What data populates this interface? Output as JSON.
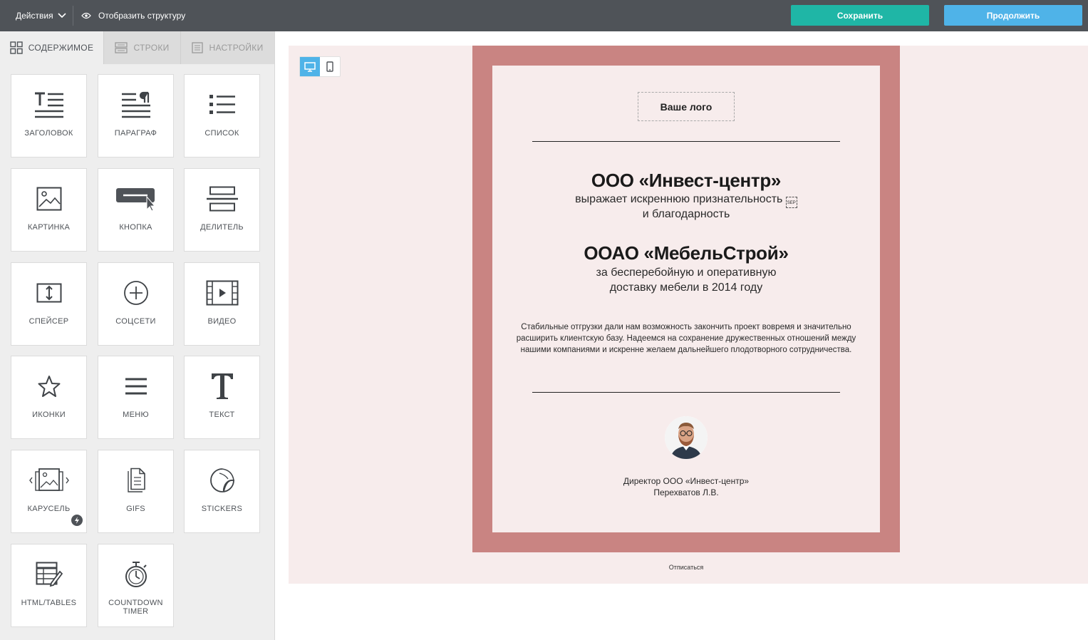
{
  "topbar": {
    "actions_label": "Действия",
    "structure_label": "Отобразить структуру",
    "save_label": "Сохранить",
    "continue_label": "Продолжить"
  },
  "sidebar": {
    "tabs": [
      {
        "label": "СОДЕРЖИМОЕ",
        "icon": "grid-icon",
        "active": true
      },
      {
        "label": "СТРОКИ",
        "icon": "rows-icon",
        "active": false
      },
      {
        "label": "НАСТРОЙКИ",
        "icon": "settings-doc-icon",
        "active": false
      }
    ],
    "blocks": [
      {
        "label": "ЗАГОЛОВОК",
        "icon": "heading-icon"
      },
      {
        "label": "ПАРАГРАФ",
        "icon": "paragraph-icon"
      },
      {
        "label": "СПИСОК",
        "icon": "list-icon"
      },
      {
        "label": "КАРТИНКА",
        "icon": "image-icon"
      },
      {
        "label": "КНОПКА",
        "icon": "button-icon"
      },
      {
        "label": "ДЕЛИТЕЛЬ",
        "icon": "divider-icon"
      },
      {
        "label": "СПЕЙСЕР",
        "icon": "spacer-icon"
      },
      {
        "label": "СОЦСЕТИ",
        "icon": "social-icon"
      },
      {
        "label": "ВИДЕО",
        "icon": "video-icon"
      },
      {
        "label": "ИКОНКИ",
        "icon": "star-icon"
      },
      {
        "label": "МЕНЮ",
        "icon": "menu-icon"
      },
      {
        "label": "ТЕКСТ",
        "icon": "text-icon"
      },
      {
        "label": "КАРУСЕЛЬ",
        "icon": "carousel-icon"
      },
      {
        "label": "GIFS",
        "icon": "gifs-icon"
      },
      {
        "label": "STICKERS",
        "icon": "sticker-icon"
      },
      {
        "label": "HTML/TABLES",
        "icon": "html-tables-icon"
      },
      {
        "label": "COUNTDOWN TIMER",
        "icon": "timer-icon"
      }
    ]
  },
  "email": {
    "logo_placeholder": "Ваше лого",
    "company_from": "ООО «Инвест-центр»",
    "gratitude_line1": "выражает искреннюю признательность ",
    "gratitude_line2": "и благодарность",
    "company_to": "ООАО «МебельСтрой»",
    "reason_line1": "за бесперебойную и оперативную",
    "reason_line2": "доставку мебели в 2014 году",
    "body_text": "Стабильные отгрузки дали нам возможность закончить проект вовремя и значительно расширить клиентскую базу. Надеемся на сохранение дружественных отношений между нашими компаниями и искренне желаем дальнейшего плодотворного сотрудничества.",
    "signer_title": "Директор ООО «Инвест-центр»",
    "signer_name": "Перехватов Л.В.",
    "unsubscribe": "Отписаться"
  },
  "colors": {
    "topbar": "#4f5358",
    "save": "#1fb6a6",
    "continue": "#4fb3e8",
    "frame": "#c98482",
    "card_bg": "#f7ecec"
  }
}
